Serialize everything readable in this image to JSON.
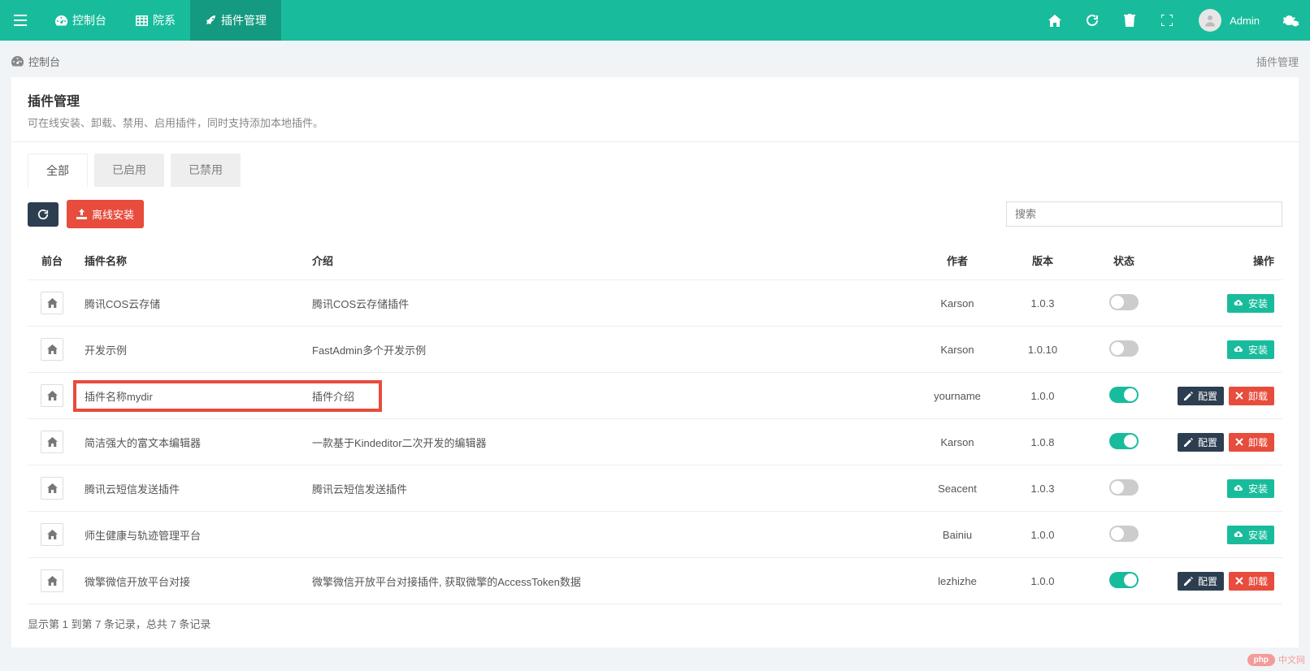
{
  "topbar": {
    "tabs": [
      {
        "icon": "dashboard",
        "label": "控制台"
      },
      {
        "icon": "table",
        "label": "院系"
      },
      {
        "icon": "rocket",
        "label": "插件管理"
      }
    ],
    "active_tab": 2,
    "user_name": "Admin"
  },
  "breadcrumb": {
    "left": "控制台",
    "right": "插件管理"
  },
  "panel": {
    "title": "插件管理",
    "subtitle": "可在线安装、卸载、禁用、启用插件，同时支持添加本地插件。"
  },
  "content_tabs": {
    "items": [
      "全部",
      "已启用",
      "已禁用"
    ],
    "active": 0
  },
  "toolbar": {
    "offline_install": "离线安装",
    "search_placeholder": "搜索"
  },
  "table": {
    "headers": {
      "front": "前台",
      "name": "插件名称",
      "desc": "介绍",
      "author": "作者",
      "version": "版本",
      "state": "状态",
      "action": "操作"
    },
    "rows": [
      {
        "name": "腾讯COS云存储",
        "desc": "腾讯COS云存储插件",
        "author": "Karson",
        "version": "1.0.3",
        "state": false,
        "actions": "install",
        "highlight": false
      },
      {
        "name": "开发示例",
        "desc": "FastAdmin多个开发示例",
        "author": "Karson",
        "version": "1.0.10",
        "state": false,
        "actions": "install",
        "highlight": false
      },
      {
        "name": "插件名称mydir",
        "desc": "插件介绍",
        "author": "yourname",
        "version": "1.0.0",
        "state": true,
        "actions": "manage",
        "highlight": true
      },
      {
        "name": "简洁强大的富文本编辑器",
        "desc": "一款基于Kindeditor二次开发的编辑器",
        "author": "Karson",
        "version": "1.0.8",
        "state": true,
        "actions": "manage",
        "highlight": false
      },
      {
        "name": "腾讯云短信发送插件",
        "desc": "腾讯云短信发送插件",
        "author": "Seacent",
        "version": "1.0.3",
        "state": false,
        "actions": "install",
        "highlight": false
      },
      {
        "name": "师生健康与轨迹管理平台",
        "desc": "",
        "author": "Bainiu",
        "version": "1.0.0",
        "state": false,
        "actions": "install",
        "highlight": false
      },
      {
        "name": "微擎微信开放平台对接",
        "desc": "微擎微信开放平台对接插件, 获取微擎的AccessToken数据",
        "author": "lezhizhe",
        "version": "1.0.0",
        "state": true,
        "actions": "manage",
        "highlight": false
      }
    ]
  },
  "action_labels": {
    "install": "安装",
    "config": "配置",
    "uninstall": "卸载"
  },
  "footer": "显示第 1 到第 7 条记录，总共 7 条记录",
  "watermark": {
    "badge": "php",
    "text": "中文网"
  }
}
